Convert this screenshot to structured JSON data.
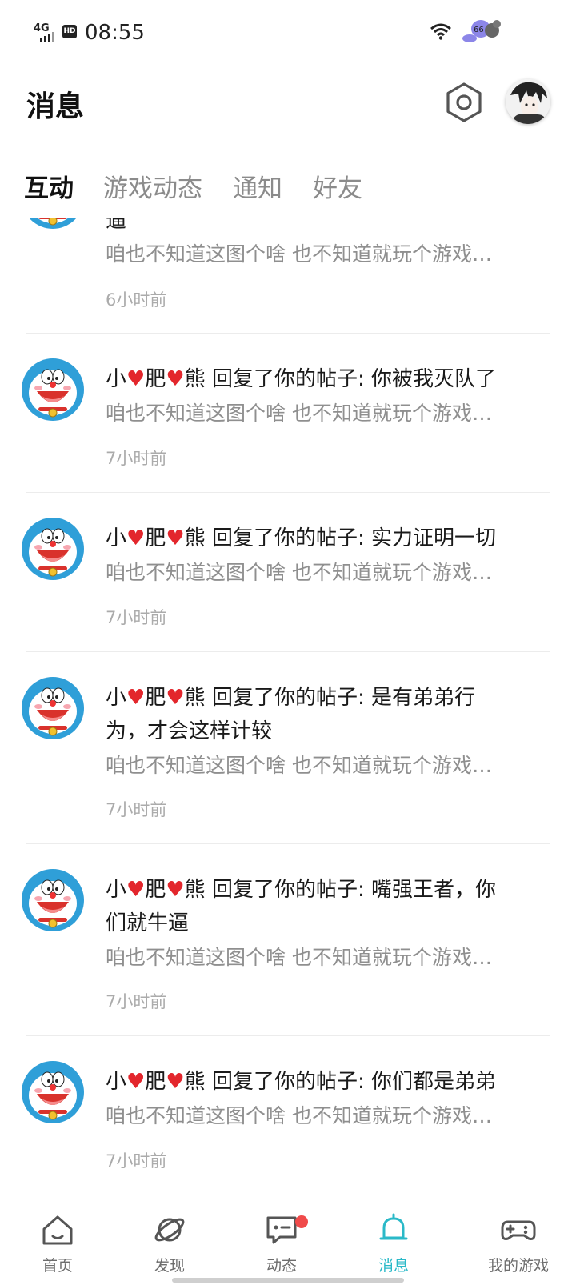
{
  "status_bar": {
    "network": "4G",
    "hd": "HD",
    "time": "08:55",
    "battery_level": "66"
  },
  "header": {
    "title": "消息"
  },
  "tabs": [
    {
      "label": "互动",
      "active": true
    },
    {
      "label": "游戏动态",
      "active": false
    },
    {
      "label": "通知",
      "active": false
    },
    {
      "label": "好友",
      "active": false
    }
  ],
  "messages": [
    {
      "user": "",
      "action": "",
      "content_lines": [
        "逼"
      ],
      "preview": "咱也不知道这图个啥  也不知道就玩个游戏…",
      "time": "6小时前"
    },
    {
      "user_parts": [
        "小",
        "♥",
        "肥",
        "♥",
        "熊"
      ],
      "action": "回复了你的帖子:",
      "content_lines": [
        "你被我灭队了"
      ],
      "preview": "咱也不知道这图个啥  也不知道就玩个游戏…",
      "time": "7小时前"
    },
    {
      "user_parts": [
        "小",
        "♥",
        "肥",
        "♥",
        "熊"
      ],
      "action": "回复了你的帖子:",
      "content_lines": [
        "实力证明一切"
      ],
      "preview": "咱也不知道这图个啥  也不知道就玩个游戏…",
      "time": "7小时前"
    },
    {
      "user_parts": [
        "小",
        "♥",
        "肥",
        "♥",
        "熊"
      ],
      "action": "回复了你的帖子:",
      "content_lines": [
        "是有弟弟行",
        "为，才会这样计较"
      ],
      "preview": "咱也不知道这图个啥  也不知道就玩个游戏…",
      "time": "7小时前"
    },
    {
      "user_parts": [
        "小",
        "♥",
        "肥",
        "♥",
        "熊"
      ],
      "action": "回复了你的帖子:",
      "content_lines": [
        "嘴强王者，你",
        "们就牛逼"
      ],
      "preview": "咱也不知道这图个啥  也不知道就玩个游戏…",
      "time": "7小时前"
    },
    {
      "user_parts": [
        "小",
        "♥",
        "肥",
        "♥",
        "熊"
      ],
      "action": "回复了你的帖子:",
      "content_lines": [
        "你们都是弟弟"
      ],
      "preview": "咱也不知道这图个啥  也不知道就玩个游戏…",
      "time": "7小时前"
    }
  ],
  "bottom_nav": [
    {
      "label": "首页",
      "icon": "home-icon",
      "active": false
    },
    {
      "label": "发现",
      "icon": "planet-icon",
      "active": false
    },
    {
      "label": "动态",
      "icon": "chat-icon",
      "active": false,
      "badge": true
    },
    {
      "label": "消息",
      "icon": "bell-icon",
      "active": true
    },
    {
      "label": "我的游戏",
      "icon": "gamepad-icon",
      "active": false
    }
  ],
  "colors": {
    "accent": "#2ab9c8",
    "heart": "#e3262c",
    "badge": "#f04a4a",
    "muted": "#8f8f8f"
  }
}
